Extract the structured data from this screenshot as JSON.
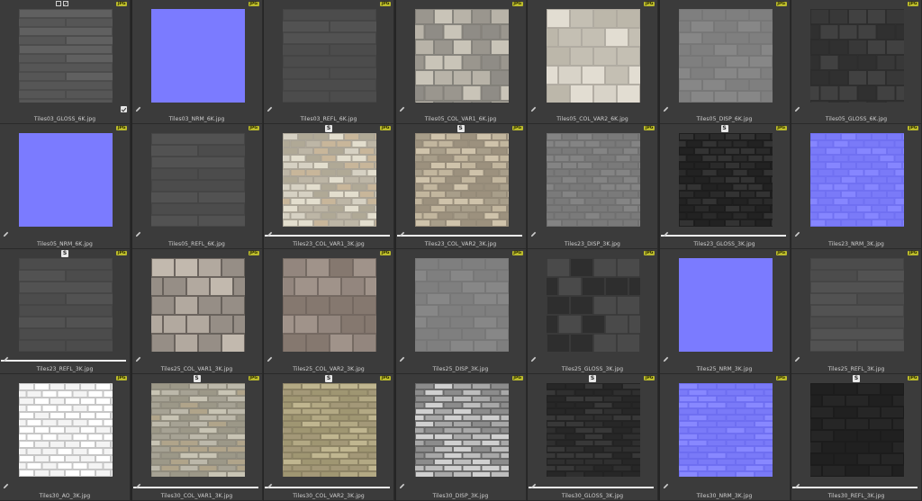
{
  "colors": {
    "background": "#2b2b2b",
    "cell": "#3b3b3b",
    "badge": "#bcbc2c",
    "normal_map": "#7b7bff"
  },
  "cells": [
    {
      "name": "Tiles03_GLOSS_6K.jpg",
      "kind": "gloss-fine",
      "badge": "JPG",
      "link": "",
      "bar": false,
      "selected": true
    },
    {
      "name": "Tiles03_NRM_6K.jpg",
      "kind": "nrm-flat",
      "badge": "JPG",
      "link": "",
      "bar": false,
      "selected": false
    },
    {
      "name": "Tiles03_REFL_6K.jpg",
      "kind": "refl-dark",
      "badge": "JPG",
      "link": "",
      "bar": false,
      "selected": false
    },
    {
      "name": "Tiles05_COL_VAR1_6K.jpg",
      "kind": "col-stone-grey",
      "badge": "JPG",
      "link": "",
      "bar": false,
      "selected": false
    },
    {
      "name": "Tiles05_COL_VAR2_6K.jpg",
      "kind": "col-stone-light",
      "badge": "JPG",
      "link": "",
      "bar": false,
      "selected": false
    },
    {
      "name": "Tiles05_DISP_6K.jpg",
      "kind": "disp-grey",
      "badge": "JPG",
      "link": "",
      "bar": false,
      "selected": false
    },
    {
      "name": "Tiles05_GLOSS_6K.jpg",
      "kind": "gloss-dark",
      "badge": "JPG",
      "link": "",
      "bar": false,
      "selected": false
    },
    {
      "name": "Tiles05_NRM_6K.jpg",
      "kind": "nrm-flat",
      "badge": "JPG",
      "link": "",
      "bar": false,
      "selected": false
    },
    {
      "name": "Tiles05_REFL_6K.jpg",
      "kind": "refl-dark",
      "badge": "JPG",
      "link": "",
      "bar": false,
      "selected": false
    },
    {
      "name": "Tiles23_COL_VAR1_3K.jpg",
      "kind": "col-brick-light",
      "badge": "JPG",
      "link": "S",
      "bar": true,
      "selected": false
    },
    {
      "name": "Tiles23_COL_VAR2_3K.jpg",
      "kind": "col-brick-warm",
      "badge": "JPG",
      "link": "S",
      "bar": true,
      "selected": false
    },
    {
      "name": "Tiles23_DISP_3K.jpg",
      "kind": "disp-brick",
      "badge": "JPG",
      "link": "",
      "bar": false,
      "selected": false
    },
    {
      "name": "Tiles23_GLOSS_3K.jpg",
      "kind": "gloss-brick-dark",
      "badge": "JPG",
      "link": "S",
      "bar": true,
      "selected": false
    },
    {
      "name": "Tiles23_NRM_3K.jpg",
      "kind": "nrm-brick",
      "badge": "JPG",
      "link": "",
      "bar": false,
      "selected": false
    },
    {
      "name": "Tiles23_REFL_3K.jpg",
      "kind": "refl-dark",
      "badge": "JPG",
      "link": "S",
      "bar": true,
      "selected": false
    },
    {
      "name": "Tiles25_COL_VAR1_3K.jpg",
      "kind": "col-marble",
      "badge": "JPG",
      "link": "",
      "bar": false,
      "selected": false
    },
    {
      "name": "Tiles25_COL_VAR2_3K.jpg",
      "kind": "col-brown",
      "badge": "JPG",
      "link": "",
      "bar": false,
      "selected": false
    },
    {
      "name": "Tiles25_DISP_3K.jpg",
      "kind": "disp-grey",
      "badge": "JPG",
      "link": "",
      "bar": false,
      "selected": false
    },
    {
      "name": "Tiles25_GLOSS_3K.jpg",
      "kind": "gloss-rough",
      "badge": "JPG",
      "link": "",
      "bar": false,
      "selected": false
    },
    {
      "name": "Tiles25_NRM_3K.jpg",
      "kind": "nrm-flat",
      "badge": "JPG",
      "link": "",
      "bar": false,
      "selected": false
    },
    {
      "name": "Tiles25_REFL_3K.jpg",
      "kind": "refl-dark",
      "badge": "JPG",
      "link": "",
      "bar": false,
      "selected": false
    },
    {
      "name": "Tiles30_AO_3K.jpg",
      "kind": "ao-white",
      "badge": "JPG",
      "link": "",
      "bar": false,
      "selected": false
    },
    {
      "name": "Tiles30_COL_VAR1_3K.jpg",
      "kind": "col-strip-grey",
      "badge": "JPG",
      "link": "S",
      "bar": true,
      "selected": false
    },
    {
      "name": "Tiles30_COL_VAR2_3K.jpg",
      "kind": "col-strip-olive",
      "badge": "JPG",
      "link": "S",
      "bar": true,
      "selected": false
    },
    {
      "name": "Tiles30_DISP_3K.jpg",
      "kind": "disp-strip",
      "badge": "JPG",
      "link": "",
      "bar": false,
      "selected": false
    },
    {
      "name": "Tiles30_GLOSS_3K.jpg",
      "kind": "gloss-strip-dark",
      "badge": "JPG",
      "link": "S",
      "bar": true,
      "selected": false
    },
    {
      "name": "Tiles30_NRM_3K.jpg",
      "kind": "nrm-strip",
      "badge": "JPG",
      "link": "",
      "bar": false,
      "selected": false
    },
    {
      "name": "Tiles30_REFL_3K.jpg",
      "kind": "refl-black",
      "badge": "JPG",
      "link": "S",
      "bar": true,
      "selected": false
    }
  ]
}
